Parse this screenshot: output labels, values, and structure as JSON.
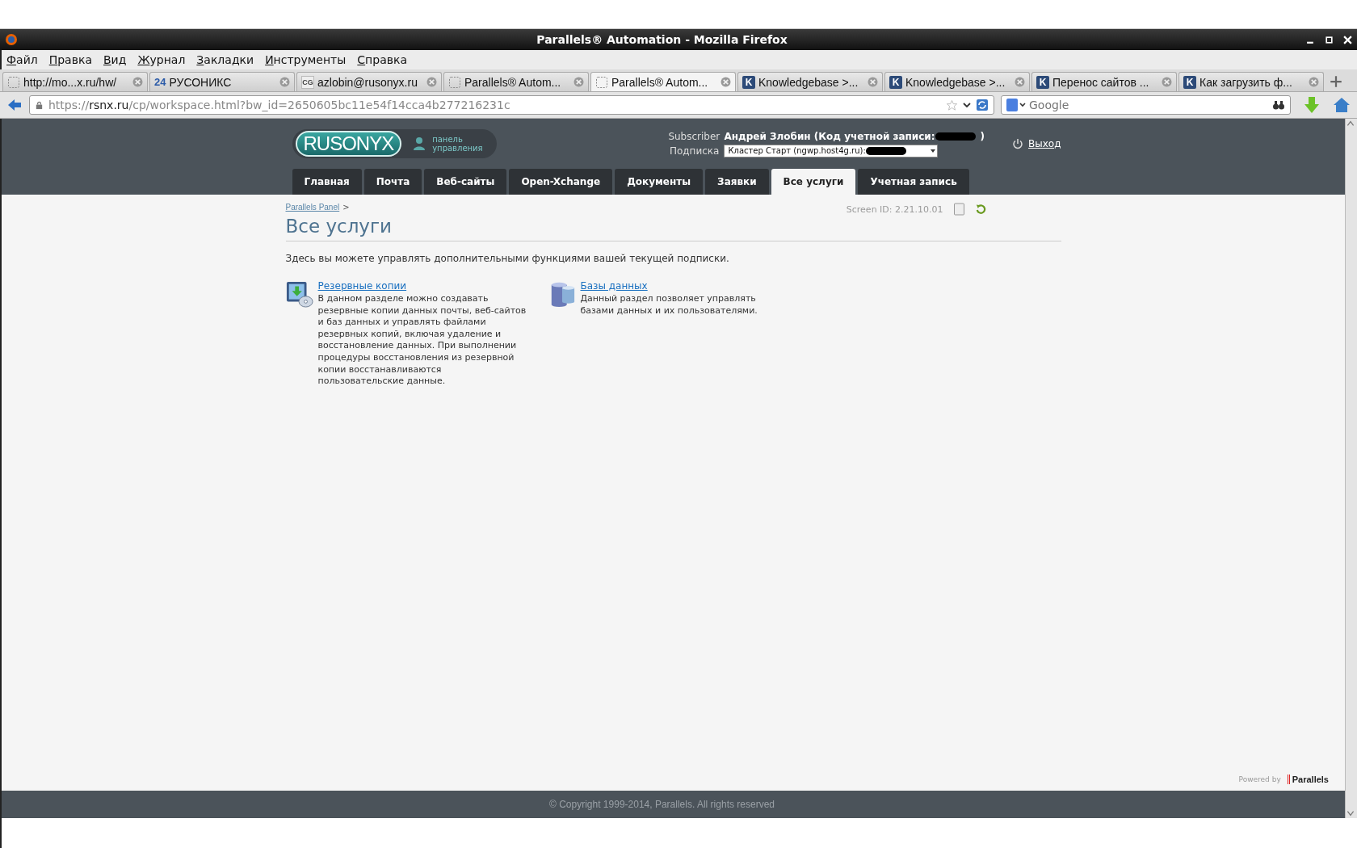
{
  "window": {
    "title": "Parallels® Automation - Mozilla Firefox"
  },
  "menu": [
    "Файл",
    "Правка",
    "Вид",
    "Журнал",
    "Закладки",
    "Инструменты",
    "Справка"
  ],
  "browser_tabs": [
    {
      "label": "http://mo...x.ru/hw/",
      "selected": false,
      "kind": "blank"
    },
    {
      "label": "РУСОНИКС",
      "selected": false,
      "kind": "numeral",
      "icon_text": "24"
    },
    {
      "label": "azlobin@rusonyx.ru",
      "selected": false,
      "kind": "badge",
      "icon_text": "CG"
    },
    {
      "label": "Parallels® Autom...",
      "selected": false,
      "kind": "blank"
    },
    {
      "label": "Parallels® Autom...",
      "selected": true,
      "kind": "blank"
    },
    {
      "label": "Knowledgebase >...",
      "selected": false,
      "kind": "letter",
      "icon_text": "K"
    },
    {
      "label": "Knowledgebase >...",
      "selected": false,
      "kind": "letter",
      "icon_text": "K"
    },
    {
      "label": "Перенос сайтов ...",
      "selected": false,
      "kind": "letter",
      "icon_text": "K"
    },
    {
      "label": "Как загрузить ф...",
      "selected": false,
      "kind": "letter",
      "icon_text": "K"
    }
  ],
  "address_bar": {
    "scheme": "https://",
    "host": "rsnx.ru",
    "path": "/cp/workspace.html?bw_id=2650605bc11e54f14cca4b277216231c"
  },
  "search_field": {
    "placeholder": "Google"
  },
  "header": {
    "logo_text": "RUSONYX",
    "logo_subtitle": "панель управления",
    "subscriber_label": "Subscriber",
    "subscriber_name": "Андрей Злобин (Код учетной записи:",
    "subscriber_suffix": ")",
    "subscription_label": "Подписка",
    "subscription_value": "Кластер Старт (ngwp.host4g.ru):",
    "logout": "Выход"
  },
  "nav_tabs": [
    {
      "label": "Главная",
      "selected": false
    },
    {
      "label": "Почта",
      "selected": false
    },
    {
      "label": "Веб-сайты",
      "selected": false
    },
    {
      "label": "Open-Xchange",
      "selected": false
    },
    {
      "label": "Документы",
      "selected": false
    },
    {
      "label": "Заявки",
      "selected": false
    },
    {
      "label": "Все услуги",
      "selected": true
    },
    {
      "label": "Учетная запись",
      "selected": false
    }
  ],
  "breadcrumb": {
    "link": "Parallels Panel",
    "separator": ">"
  },
  "screen_id": "Screen ID:  2.21.10.01",
  "page_title": "Все услуги",
  "intro": "Здесь вы можете управлять дополнительными функциями вашей текущей подписки.",
  "services": [
    {
      "kind": "backup",
      "title": "Резервные копии",
      "description": "В данном разделе можно создавать резервные копии данных почты, веб-сайтов и баз данных и управлять файлами резервных копий, включая удаление и восстановление данных. При выполнении процедуры восстановления из резервной копии восстанавливаются пользовательские данные."
    },
    {
      "kind": "database",
      "title": "Базы данных",
      "description": "Данный раздел позволяет управлять базами данных и их пользователями."
    }
  ],
  "powered_by": {
    "label": "Powered by",
    "brand": "Parallels"
  },
  "footer": {
    "copyright": "© Copyright 1999-2014, Parallels. All rights reserved"
  }
}
